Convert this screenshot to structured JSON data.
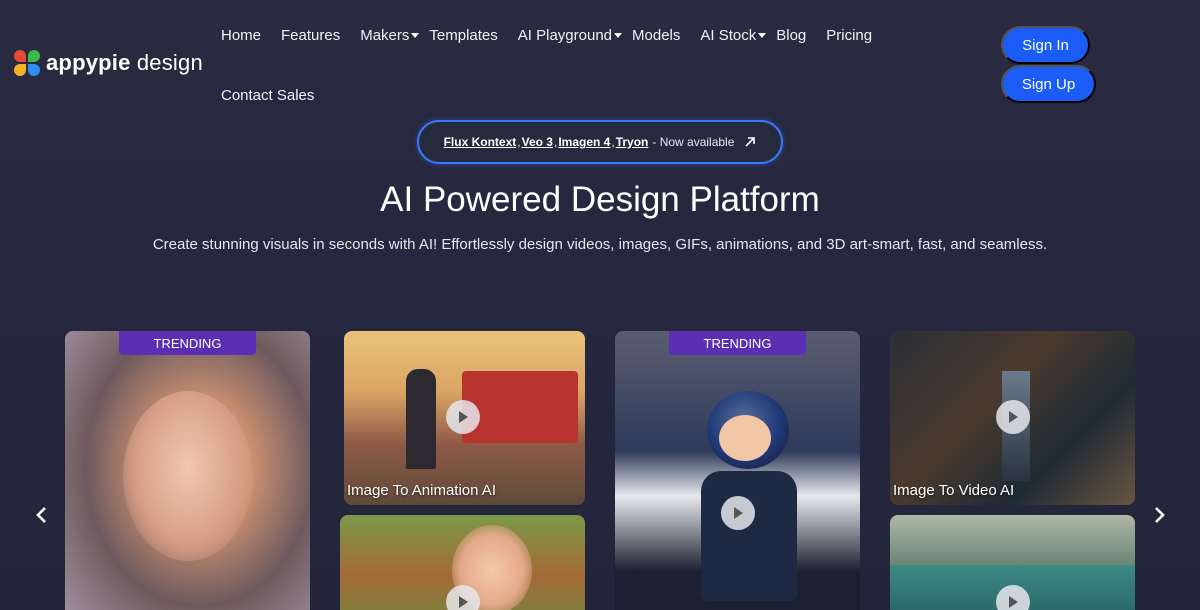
{
  "brand": {
    "name_bold": "appypie",
    "name_rest": " design"
  },
  "nav": {
    "items": [
      {
        "label": "Home",
        "dropdown": false
      },
      {
        "label": "Features",
        "dropdown": false
      },
      {
        "label": "Makers",
        "dropdown": true
      },
      {
        "label": "Templates",
        "dropdown": false
      },
      {
        "label": "AI Playground",
        "dropdown": true
      },
      {
        "label": "Models",
        "dropdown": false
      },
      {
        "label": "AI Stock",
        "dropdown": true
      },
      {
        "label": "Blog",
        "dropdown": false
      },
      {
        "label": "Pricing",
        "dropdown": false
      }
    ],
    "second_row": "Contact Sales"
  },
  "auth": {
    "sign_in": "Sign In",
    "sign_up": "Sign Up"
  },
  "announcement": {
    "links": [
      "Flux Kontext",
      "Veo 3",
      "Imagen 4",
      "Tryon"
    ],
    "suffix": "- Now available"
  },
  "hero": {
    "title": "AI Powered Design Platform",
    "subtitle": "Create stunning visuals in seconds with AI! Effortlessly design videos, images, GIFs, animations, and 3D art-smart, fast, and seamless."
  },
  "cards": [
    {
      "badge": "TRENDING",
      "label": ""
    },
    {
      "badge": "",
      "label": "Image To Animation AI"
    },
    {
      "badge": "",
      "label": ""
    },
    {
      "badge": "TRENDING",
      "label": ""
    },
    {
      "badge": "",
      "label": "Image To Video AI"
    },
    {
      "badge": "",
      "label": ""
    }
  ],
  "colors": {
    "accent": "#1a5cf5",
    "badge": "#5b2fb4",
    "announce_border": "#3a78ff"
  },
  "icons": {
    "carousel_prev": "chevron-left-icon",
    "carousel_next": "chevron-right-icon",
    "play": "play-icon",
    "external": "arrow-up-right-icon"
  }
}
